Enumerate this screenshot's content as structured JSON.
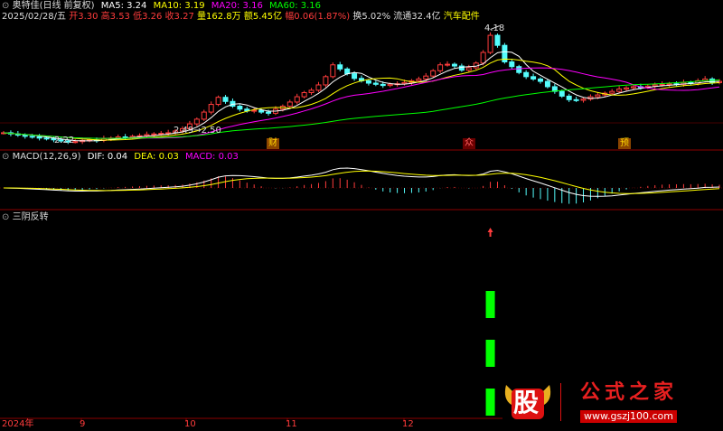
{
  "header": {
    "title": "奥特佳(日线 前复权)",
    "ma5": "MA5: 3.24",
    "ma10": "MA10: 3.19",
    "ma20": "MA20: 3.16",
    "ma60": "MA60: 3.16",
    "line2": {
      "date": "2025/02/28/五",
      "open": "开3.30",
      "high": "高3.53",
      "low": "低3.26",
      "close": "收3.27",
      "volume": "量162.8万",
      "amount": "额5.45亿",
      "change": "幅0.06(1.87%)",
      "turnover": "换5.02%",
      "float": "流通32.4亿",
      "sector": "汽车配件"
    }
  },
  "annotations": {
    "high_label": "4.18",
    "low_label": "2.22",
    "range_label": "2.49→2.50",
    "badge1": "财",
    "badge2": "众",
    "badge3": "预"
  },
  "macd_header": {
    "name": "MACD(12,26,9)",
    "dif": "DIF: 0.04",
    "dea": "DEA: 0.03",
    "macd": "MACD: 0.03"
  },
  "indicator_header": {
    "name": "三阴反转"
  },
  "xaxis": {
    "labels": [
      "2024年",
      "9",
      "10",
      "11",
      "12"
    ]
  },
  "watermark": {
    "logo": "股",
    "title": "公式之家",
    "url": "www.gszj100.com"
  },
  "colors": {
    "up": "#ff3c3c",
    "down": "#54fcfc",
    "ma5": "#ffffff",
    "ma10": "#ffff00",
    "ma20": "#ff00ff",
    "ma60": "#00ff00",
    "signal": "#00ff00"
  },
  "chart_data": [
    {
      "type": "candlestick",
      "title": "奥特佳(日线 前复权)",
      "price_range": [
        2.2,
        4.25
      ],
      "close": [
        2.4,
        2.38,
        2.36,
        2.34,
        2.33,
        2.31,
        2.3,
        2.28,
        2.26,
        2.25,
        2.25,
        2.27,
        2.28,
        2.27,
        2.3,
        2.31,
        2.33,
        2.32,
        2.34,
        2.35,
        2.37,
        2.38,
        2.39,
        2.4,
        2.43,
        2.47,
        2.55,
        2.63,
        2.75,
        2.88,
        3.0,
        2.93,
        2.85,
        2.8,
        2.77,
        2.78,
        2.75,
        2.73,
        2.8,
        2.85,
        2.92,
        3.01,
        3.08,
        3.12,
        3.21,
        3.35,
        3.55,
        3.48,
        3.4,
        3.32,
        3.28,
        3.24,
        3.22,
        3.2,
        3.22,
        3.23,
        3.25,
        3.28,
        3.31,
        3.36,
        3.45,
        3.55,
        3.56,
        3.53,
        3.46,
        3.5,
        3.58,
        3.76,
        4.05,
        3.88,
        3.6,
        3.52,
        3.42,
        3.35,
        3.31,
        3.27,
        3.18,
        3.1,
        3.02,
        2.96,
        2.95,
        2.97,
        3.01,
        3.04,
        3.07,
        3.1,
        3.14,
        3.16,
        3.18,
        3.17,
        3.19,
        3.21,
        3.22,
        3.23,
        3.22,
        3.25,
        3.24,
        3.28,
        3.31,
        3.25,
        3.27
      ],
      "series": [
        {
          "name": "MA5",
          "values": [
            3.24
          ]
        },
        {
          "name": "MA10",
          "values": [
            3.19
          ]
        },
        {
          "name": "MA20",
          "values": [
            3.16
          ]
        },
        {
          "name": "MA60",
          "values": [
            3.16
          ]
        }
      ],
      "annotations": [
        {
          "label": "4.18"
        },
        {
          "label": "2.22"
        },
        {
          "label": "2.49→2.50"
        }
      ]
    },
    {
      "type": "bar",
      "title": "MACD(12,26,9)",
      "series": [
        {
          "name": "DIF",
          "values": [
            0.04
          ]
        },
        {
          "name": "DEA",
          "values": [
            0.03
          ]
        },
        {
          "name": "MACD",
          "values": [
            0.03
          ]
        }
      ]
    },
    {
      "type": "bar",
      "title": "三阴反转",
      "signal_index": 68,
      "values": [
        1,
        1,
        1
      ]
    }
  ]
}
